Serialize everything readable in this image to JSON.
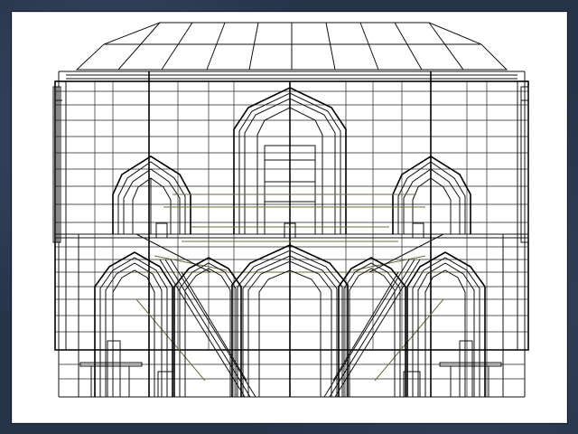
{
  "viewport": {
    "background": "#ffffff",
    "line_color": "#111111",
    "accent_line_color": "#6d6a3c"
  }
}
